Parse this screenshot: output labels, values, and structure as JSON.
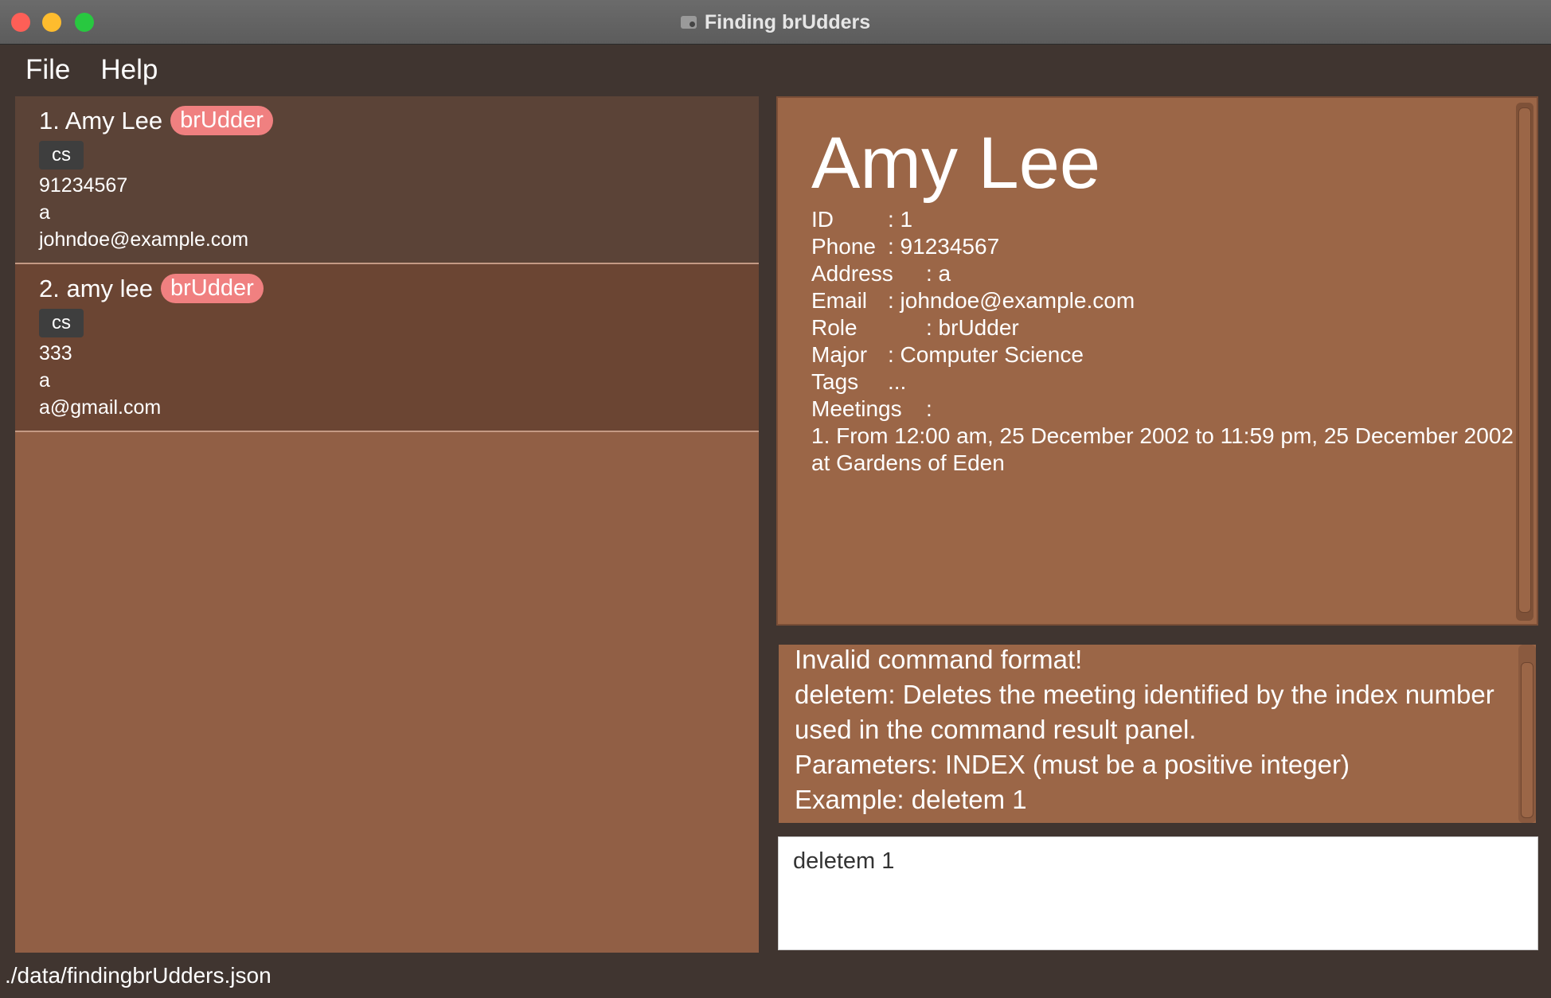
{
  "window": {
    "title": "Finding brUdders"
  },
  "menu": {
    "file": "File",
    "help": "Help"
  },
  "persons": [
    {
      "index_name": "1. Amy Lee",
      "role": "brUdder",
      "tag": "cs",
      "phone": "91234567",
      "address": "a",
      "email": "johndoe@example.com"
    },
    {
      "index_name": "2. amy lee",
      "role": "brUdder",
      "tag": "cs",
      "phone": "333",
      "address": "a",
      "email": "a@gmail.com"
    }
  ],
  "detail": {
    "name": "Amy Lee",
    "id_label": "ID",
    "id_value": ": 1",
    "phone_label": "Phone",
    "phone_value": ": 91234567",
    "address_label": "Address",
    "address_value": ": a",
    "email_label": "Email",
    "email_value": ": johndoe@example.com",
    "role_label": "Role",
    "role_value": ": brUdder",
    "major_label": "Major",
    "major_value": ": Computer Science",
    "tags_label": "Tags",
    "tags_value": "...",
    "meetings_label": "Meetings",
    "meetings_value": ":",
    "meeting_line1": "1. From 12:00 am, 25 December 2002 to 11:59 pm, 25 December 2002",
    "meeting_line2": "at Gardens of Eden"
  },
  "result": {
    "lines": [
      "Invalid command format!",
      "deletem: Deletes the meeting identified by the index number",
      "used in the command result panel.",
      "Parameters: INDEX (must be a positive integer)",
      "Example: deletem 1"
    ]
  },
  "command": {
    "value": "deletem 1"
  },
  "status": {
    "path": "./data/findingbrUdders.json"
  },
  "colors": {
    "badge": "#f08080",
    "panel": "#9b6647",
    "list_bg": "#915f45",
    "window_bg": "#403530"
  }
}
